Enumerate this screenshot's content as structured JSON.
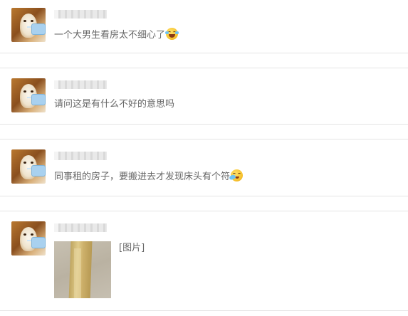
{
  "comments": [
    {
      "text": "一个大男生看房太不细心了",
      "emoji": "laugh-cry-emoji"
    },
    {
      "text": "请问这是有什么不好的意思吗"
    },
    {
      "text": "同事租的房子，要搬进去才发现床头有个符",
      "emoji": "wipe-tears-emoji"
    },
    {
      "image_label": "[图片]"
    }
  ]
}
